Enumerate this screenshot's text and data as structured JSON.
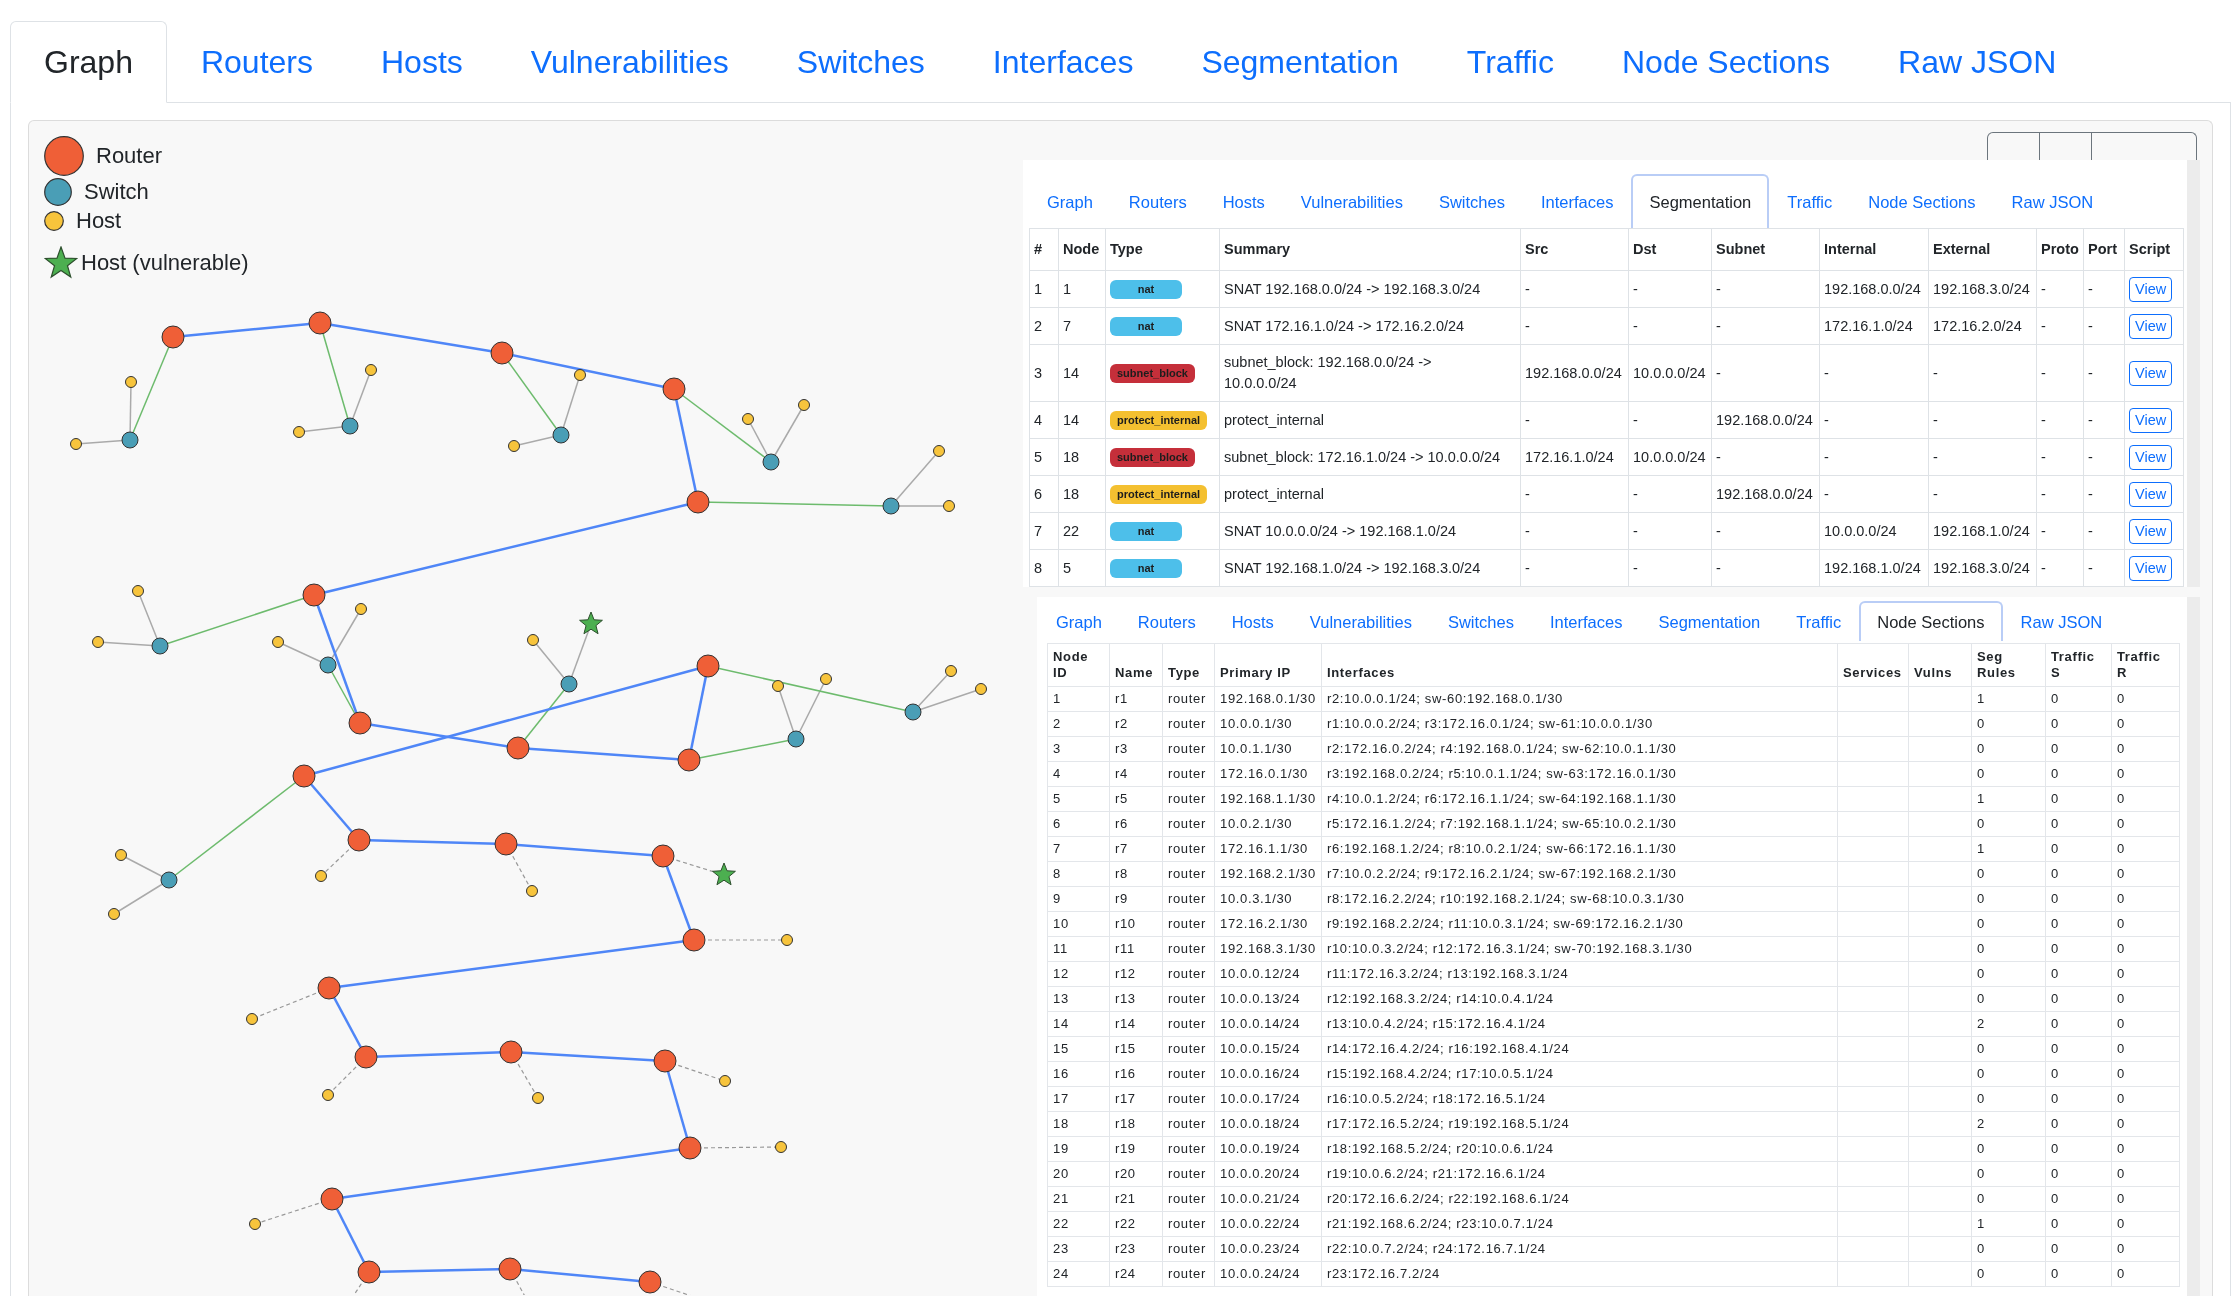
{
  "tabs": [
    {
      "label": "Graph",
      "selected": true
    },
    {
      "label": "Routers",
      "selected": false
    },
    {
      "label": "Hosts",
      "selected": false
    },
    {
      "label": "Vulnerabilities",
      "selected": false
    },
    {
      "label": "Switches",
      "selected": false
    },
    {
      "label": "Interfaces",
      "selected": false
    },
    {
      "label": "Segmentation",
      "selected": false
    },
    {
      "label": "Traffic",
      "selected": false
    },
    {
      "label": "Node Sections",
      "selected": false
    },
    {
      "label": "Raw JSON",
      "selected": false
    }
  ],
  "graph": {
    "legend": [
      {
        "kind": "router",
        "label": "Router"
      },
      {
        "kind": "switch",
        "label": "Switch"
      },
      {
        "kind": "host",
        "label": "Host"
      },
      {
        "kind": "vulnerable_host",
        "label": "Host (vulnerable)"
      }
    ]
  },
  "segmentation_panel": {
    "tabs": [
      {
        "label": "Graph",
        "selected": false
      },
      {
        "label": "Routers",
        "selected": false
      },
      {
        "label": "Hosts",
        "selected": false
      },
      {
        "label": "Vulnerabilities",
        "selected": false
      },
      {
        "label": "Switches",
        "selected": false
      },
      {
        "label": "Interfaces",
        "selected": false
      },
      {
        "label": "Segmentation",
        "selected": true
      },
      {
        "label": "Traffic",
        "selected": false
      },
      {
        "label": "Node Sections",
        "selected": false
      },
      {
        "label": "Raw JSON",
        "selected": false
      }
    ],
    "table": {
      "columns": [
        "#",
        "Node",
        "Type",
        "Summary",
        "Src",
        "Dst",
        "Subnet",
        "Internal",
        "External",
        "Proto",
        "Port",
        "Script"
      ],
      "rows": [
        {
          "number": "1",
          "node": "1",
          "type": {
            "label": "nat",
            "color": "#4dbfea"
          },
          "summary": "SNAT 192.168.0.0/24 -> 192.168.3.0/24",
          "src": "-",
          "dst": "-",
          "subnet": "-",
          "internal": "192.168.0.0/24",
          "external": "192.168.3.0/24",
          "proto": "-",
          "port": "-",
          "script": "View"
        },
        {
          "number": "2",
          "node": "7",
          "type": {
            "label": "nat",
            "color": "#4dbfea"
          },
          "summary": "SNAT 172.16.1.0/24 -> 172.16.2.0/24",
          "src": "-",
          "dst": "-",
          "subnet": "-",
          "internal": "172.16.1.0/24",
          "external": "172.16.2.0/24",
          "proto": "-",
          "port": "-",
          "script": "View"
        },
        {
          "number": "3",
          "node": "14",
          "type": {
            "label": "subnet_block",
            "color": "#c52f3a"
          },
          "summary": "subnet_block: 192.168.0.0/24 -> 10.0.0.0/24",
          "src": "192.168.0.0/24",
          "dst": "10.0.0.0/24",
          "subnet": "-",
          "internal": "-",
          "external": "-",
          "proto": "-",
          "port": "-",
          "script": "View"
        },
        {
          "number": "4",
          "node": "14",
          "type": {
            "label": "protect_internal",
            "color": "#f4c030"
          },
          "summary": "protect_internal",
          "src": "-",
          "dst": "-",
          "subnet": "192.168.0.0/24",
          "internal": "-",
          "external": "-",
          "proto": "-",
          "port": "-",
          "script": "View"
        },
        {
          "number": "5",
          "node": "18",
          "type": {
            "label": "subnet_block",
            "color": "#c52f3a"
          },
          "summary": "subnet_block: 172.16.1.0/24 -> 10.0.0.0/24",
          "src": "172.16.1.0/24",
          "dst": "10.0.0.0/24",
          "subnet": "-",
          "internal": "-",
          "external": "-",
          "proto": "-",
          "port": "-",
          "script": "View"
        },
        {
          "number": "6",
          "node": "18",
          "type": {
            "label": "protect_internal",
            "color": "#f4c030"
          },
          "summary": "protect_internal",
          "src": "-",
          "dst": "-",
          "subnet": "192.168.0.0/24",
          "internal": "-",
          "external": "-",
          "proto": "-",
          "port": "-",
          "script": "View"
        },
        {
          "number": "7",
          "node": "22",
          "type": {
            "label": "nat",
            "color": "#4dbfea"
          },
          "summary": "SNAT 10.0.0.0/24 -> 192.168.1.0/24",
          "src": "-",
          "dst": "-",
          "subnet": "-",
          "internal": "10.0.0.0/24",
          "external": "192.168.1.0/24",
          "proto": "-",
          "port": "-",
          "script": "View"
        },
        {
          "number": "8",
          "node": "5",
          "type": {
            "label": "nat",
            "color": "#4dbfea"
          },
          "summary": "SNAT 192.168.1.0/24 -> 192.168.3.0/24",
          "src": "-",
          "dst": "-",
          "subnet": "-",
          "internal": "192.168.1.0/24",
          "external": "192.168.3.0/24",
          "proto": "-",
          "port": "-",
          "script": "View"
        }
      ]
    }
  },
  "node_sections_panel": {
    "tabs": [
      {
        "label": "Graph",
        "selected": false
      },
      {
        "label": "Routers",
        "selected": false
      },
      {
        "label": "Hosts",
        "selected": false
      },
      {
        "label": "Vulnerabilities",
        "selected": false
      },
      {
        "label": "Switches",
        "selected": false
      },
      {
        "label": "Interfaces",
        "selected": false
      },
      {
        "label": "Segmentation",
        "selected": false
      },
      {
        "label": "Traffic",
        "selected": false
      },
      {
        "label": "Node Sections",
        "selected": true
      },
      {
        "label": "Raw JSON",
        "selected": false
      }
    ],
    "table": {
      "columns": [
        "Node ID",
        "Name",
        "Type",
        "Primary IP",
        "Interfaces",
        "Services",
        "Vulns",
        "Seg Rules",
        "Traffic S",
        "Traffic R"
      ],
      "rows": [
        {
          "node_id": "1",
          "name": "r1",
          "type": "router",
          "primary_ip": "192.168.0.1/30",
          "interfaces": "r2:10.0.0.1/24; sw-60:192.168.0.1/30",
          "seg_rules": "1",
          "traffic_s": "0",
          "traffic_r": "0"
        },
        {
          "node_id": "2",
          "name": "r2",
          "type": "router",
          "primary_ip": "10.0.0.1/30",
          "interfaces": "r1:10.0.0.2/24; r3:172.16.0.1/24; sw-61:10.0.0.1/30",
          "seg_rules": "0",
          "traffic_s": "0",
          "traffic_r": "0"
        },
        {
          "node_id": "3",
          "name": "r3",
          "type": "router",
          "primary_ip": "10.0.1.1/30",
          "interfaces": "r2:172.16.0.2/24; r4:192.168.0.1/24; sw-62:10.0.1.1/30",
          "seg_rules": "0",
          "traffic_s": "0",
          "traffic_r": "0"
        },
        {
          "node_id": "4",
          "name": "r4",
          "type": "router",
          "primary_ip": "172.16.0.1/30",
          "interfaces": "r3:192.168.0.2/24; r5:10.0.1.1/24; sw-63:172.16.0.1/30",
          "seg_rules": "0",
          "traffic_s": "0",
          "traffic_r": "0"
        },
        {
          "node_id": "5",
          "name": "r5",
          "type": "router",
          "primary_ip": "192.168.1.1/30",
          "interfaces": "r4:10.0.1.2/24; r6:172.16.1.1/24; sw-64:192.168.1.1/30",
          "seg_rules": "1",
          "traffic_s": "0",
          "traffic_r": "0"
        },
        {
          "node_id": "6",
          "name": "r6",
          "type": "router",
          "primary_ip": "10.0.2.1/30",
          "interfaces": "r5:172.16.1.2/24; r7:192.168.1.1/24; sw-65:10.0.2.1/30",
          "seg_rules": "0",
          "traffic_s": "0",
          "traffic_r": "0"
        },
        {
          "node_id": "7",
          "name": "r7",
          "type": "router",
          "primary_ip": "172.16.1.1/30",
          "interfaces": "r6:192.168.1.2/24; r8:10.0.2.1/24; sw-66:172.16.1.1/30",
          "seg_rules": "1",
          "traffic_s": "0",
          "traffic_r": "0"
        },
        {
          "node_id": "8",
          "name": "r8",
          "type": "router",
          "primary_ip": "192.168.2.1/30",
          "interfaces": "r7:10.0.2.2/24; r9:172.16.2.1/24; sw-67:192.168.2.1/30",
          "seg_rules": "0",
          "traffic_s": "0",
          "traffic_r": "0"
        },
        {
          "node_id": "9",
          "name": "r9",
          "type": "router",
          "primary_ip": "10.0.3.1/30",
          "interfaces": "r8:172.16.2.2/24; r10:192.168.2.1/24; sw-68:10.0.3.1/30",
          "seg_rules": "0",
          "traffic_s": "0",
          "traffic_r": "0"
        },
        {
          "node_id": "10",
          "name": "r10",
          "type": "router",
          "primary_ip": "172.16.2.1/30",
          "interfaces": "r9:192.168.2.2/24; r11:10.0.3.1/24; sw-69:172.16.2.1/30",
          "seg_rules": "0",
          "traffic_s": "0",
          "traffic_r": "0"
        },
        {
          "node_id": "11",
          "name": "r11",
          "type": "router",
          "primary_ip": "192.168.3.1/30",
          "interfaces": "r10:10.0.3.2/24; r12:172.16.3.1/24; sw-70:192.168.3.1/30",
          "seg_rules": "0",
          "traffic_s": "0",
          "traffic_r": "0"
        },
        {
          "node_id": "12",
          "name": "r12",
          "type": "router",
          "primary_ip": "10.0.0.12/24",
          "interfaces": "r11:172.16.3.2/24; r13:192.168.3.1/24",
          "seg_rules": "0",
          "traffic_s": "0",
          "traffic_r": "0"
        },
        {
          "node_id": "13",
          "name": "r13",
          "type": "router",
          "primary_ip": "10.0.0.13/24",
          "interfaces": "r12:192.168.3.2/24; r14:10.0.4.1/24",
          "seg_rules": "0",
          "traffic_s": "0",
          "traffic_r": "0"
        },
        {
          "node_id": "14",
          "name": "r14",
          "type": "router",
          "primary_ip": "10.0.0.14/24",
          "interfaces": "r13:10.0.4.2/24; r15:172.16.4.1/24",
          "seg_rules": "2",
          "traffic_s": "0",
          "traffic_r": "0"
        },
        {
          "node_id": "15",
          "name": "r15",
          "type": "router",
          "primary_ip": "10.0.0.15/24",
          "interfaces": "r14:172.16.4.2/24; r16:192.168.4.1/24",
          "seg_rules": "0",
          "traffic_s": "0",
          "traffic_r": "0"
        },
        {
          "node_id": "16",
          "name": "r16",
          "type": "router",
          "primary_ip": "10.0.0.16/24",
          "interfaces": "r15:192.168.4.2/24; r17:10.0.5.1/24",
          "seg_rules": "0",
          "traffic_s": "0",
          "traffic_r": "0"
        },
        {
          "node_id": "17",
          "name": "r17",
          "type": "router",
          "primary_ip": "10.0.0.17/24",
          "interfaces": "r16:10.0.5.2/24; r18:172.16.5.1/24",
          "seg_rules": "0",
          "traffic_s": "0",
          "traffic_r": "0"
        },
        {
          "node_id": "18",
          "name": "r18",
          "type": "router",
          "primary_ip": "10.0.0.18/24",
          "interfaces": "r17:172.16.5.2/24; r19:192.168.5.1/24",
          "seg_rules": "2",
          "traffic_s": "0",
          "traffic_r": "0"
        },
        {
          "node_id": "19",
          "name": "r19",
          "type": "router",
          "primary_ip": "10.0.0.19/24",
          "interfaces": "r18:192.168.5.2/24; r20:10.0.6.1/24",
          "seg_rules": "0",
          "traffic_s": "0",
          "traffic_r": "0"
        },
        {
          "node_id": "20",
          "name": "r20",
          "type": "router",
          "primary_ip": "10.0.0.20/24",
          "interfaces": "r19:10.0.6.2/24; r21:172.16.6.1/24",
          "seg_rules": "0",
          "traffic_s": "0",
          "traffic_r": "0"
        },
        {
          "node_id": "21",
          "name": "r21",
          "type": "router",
          "primary_ip": "10.0.0.21/24",
          "interfaces": "r20:172.16.6.2/24; r22:192.168.6.1/24",
          "seg_rules": "0",
          "traffic_s": "0",
          "traffic_r": "0"
        },
        {
          "node_id": "22",
          "name": "r22",
          "type": "router",
          "primary_ip": "10.0.0.22/24",
          "interfaces": "r21:192.168.6.2/24; r23:10.0.7.1/24",
          "seg_rules": "1",
          "traffic_s": "0",
          "traffic_r": "0"
        },
        {
          "node_id": "23",
          "name": "r23",
          "type": "router",
          "primary_ip": "10.0.0.23/24",
          "interfaces": "r22:10.0.7.2/24; r24:172.16.7.1/24",
          "seg_rules": "0",
          "traffic_s": "0",
          "traffic_r": "0"
        },
        {
          "node_id": "24",
          "name": "r24",
          "type": "router",
          "primary_ip": "10.0.0.24/24",
          "interfaces": "r23:172.16.7.2/24",
          "seg_rules": "0",
          "traffic_s": "0",
          "traffic_r": "0"
        }
      ]
    }
  }
}
